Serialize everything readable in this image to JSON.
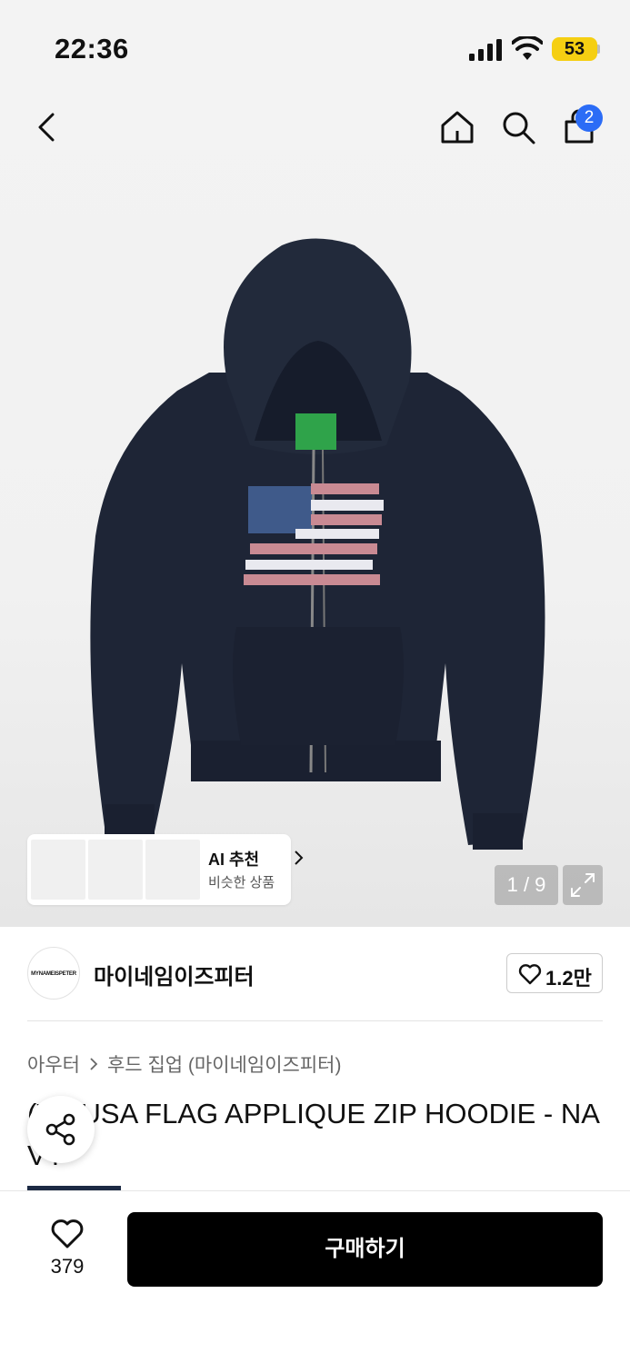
{
  "status_bar": {
    "time": "22:36",
    "battery": "53",
    "icons": [
      "signal-icon",
      "wifi-icon",
      "battery-icon"
    ]
  },
  "top_nav": {
    "icons": [
      "back-icon",
      "home-icon",
      "search-icon",
      "bag-icon"
    ],
    "cart_count": "2"
  },
  "gallery": {
    "counter": "1 / 9",
    "expand_icon": "expand-icon",
    "ai_recommend": {
      "title": "AI 추천",
      "subtitle": "비슷한 상품"
    }
  },
  "brand": {
    "logo_text": "MYNAMEISPETER",
    "name": "마이네임이즈피터",
    "likes": "1.2만"
  },
  "breadcrumb": {
    "level1": "아우터",
    "level2": "후드 집업 (마이네임이즈피터)"
  },
  "product": {
    "title": "(W) USA FLAG APPLIQUE ZIP HOODIE - NAVY"
  },
  "bottom_bar": {
    "wish_count": "379",
    "buy_label": "구매하기"
  },
  "colors": {
    "accent_blue": "#2b6cf6",
    "battery_yellow": "#f5cf12",
    "buy_button": "#000000",
    "hoodie_navy": "#1e2536"
  }
}
